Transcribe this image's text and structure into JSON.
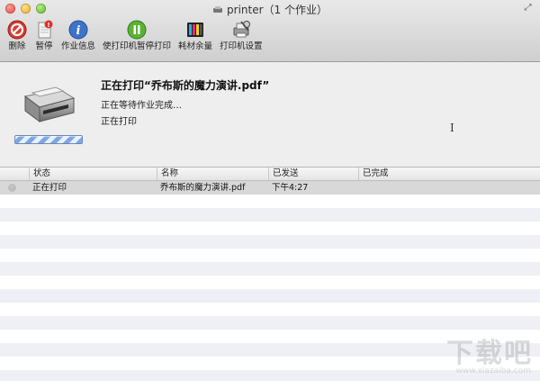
{
  "window": {
    "title": "printer（1 个作业）",
    "colors": {
      "accent": "#4a7fd1",
      "progress": "#7da6e2"
    }
  },
  "toolbar": {
    "items": [
      {
        "label": "删除",
        "icon": "delete-icon"
      },
      {
        "label": "暂停",
        "icon": "pause-icon"
      },
      {
        "label": "作业信息",
        "icon": "info-icon"
      },
      {
        "label": "使打印机暂停打印",
        "icon": "pause-printer-icon"
      },
      {
        "label": "耗材余量",
        "icon": "supply-levels-icon"
      },
      {
        "label": "打印机设置",
        "icon": "printer-settings-icon"
      }
    ]
  },
  "job": {
    "title": "正在打印“乔布斯的魔力演讲.pdf”",
    "status": "正在等待作业完成…",
    "state": "正在打印",
    "progress": 1.0
  },
  "table": {
    "columns": [
      "状态",
      "名称",
      "已发送",
      "已完成"
    ],
    "rows": [
      {
        "status": "正在打印",
        "name": "乔布斯的魔力演讲.pdf",
        "sent": "下午4:27",
        "completed": ""
      }
    ]
  },
  "watermark": {
    "text": "下载吧",
    "url": "www.xiazaiba.com"
  }
}
